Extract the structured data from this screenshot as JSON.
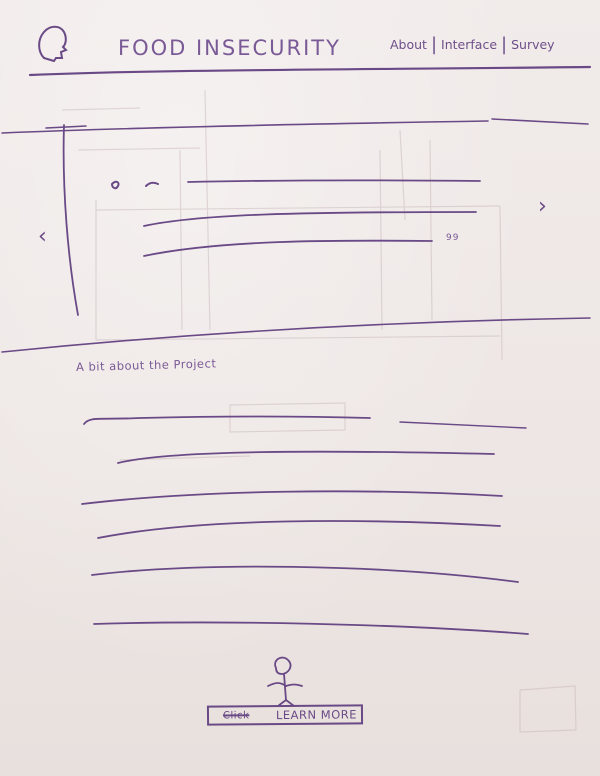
{
  "header": {
    "title": "FOOD INSECURITY",
    "nav": [
      {
        "label": "About"
      },
      {
        "label": "Interface"
      },
      {
        "label": "Survey"
      }
    ],
    "separator": "|"
  },
  "carousel": {
    "prev_glyph": "‹",
    "next_glyph": "›",
    "quote_mark": "99"
  },
  "project": {
    "heading": "A bit about the Project"
  },
  "cta": {
    "struck_label": "Click",
    "label": "LEARN MORE"
  },
  "colors": {
    "ink": "#6a4a86",
    "paper": "#efe8e7"
  },
  "icons": {
    "logo": "head-profile-icon",
    "cta_figure": "person-figure-icon"
  }
}
